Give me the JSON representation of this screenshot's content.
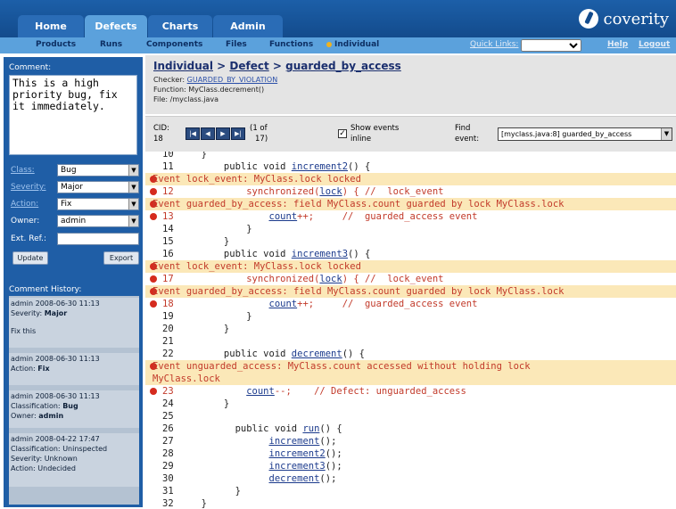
{
  "header": {
    "tabs": [
      {
        "label": "Home",
        "active": false
      },
      {
        "label": "Defects",
        "active": true
      },
      {
        "label": "Charts",
        "active": false
      },
      {
        "label": "Admin",
        "active": false
      }
    ],
    "logo_text": "coverity"
  },
  "subnav": {
    "items": [
      "Products",
      "Runs",
      "Components",
      "Files",
      "Functions",
      "Individual"
    ],
    "quick_links_label": "Quick Links:",
    "quick_links_value": "",
    "help": "Help",
    "logout": "Logout"
  },
  "sidebar": {
    "comment_label": "Comment:",
    "comment_text": "This is a high\npriority bug, fix\nit immediately.",
    "fields": [
      {
        "label": "Class:",
        "value": "Bug",
        "link": true
      },
      {
        "label": "Severity:",
        "value": "Major",
        "link": true
      },
      {
        "label": "Action:",
        "value": "Fix",
        "link": true
      },
      {
        "label": "Owner:",
        "value": "admin",
        "link": false
      }
    ],
    "ext_ref_label": "Ext. Ref.:",
    "ext_ref_value": "",
    "update_button": "Update",
    "export_button": "Export",
    "history_label": "Comment History:",
    "history": [
      {
        "line1": "admin 2008-06-30 11:13",
        "line2_key": "Severity:",
        "line2_val": "Major",
        "line3": "Fix this"
      },
      {
        "line1": "admin 2008-06-30 11:13",
        "line2_key": "Action:",
        "line2_val": "Fix",
        "line3": ""
      },
      {
        "line1": "admin 2008-06-30 11:13",
        "line2_key": "Classification:",
        "line2_val": "Bug",
        "line3_key": "Owner:",
        "line3_val": "admin"
      },
      {
        "line1": "admin 2008-04-22 17:47",
        "line2_key": "Classification:",
        "line2_val": "Uninspected",
        "line3_key": "Severity:",
        "line3_val": "Unknown",
        "line4_key": "Action:",
        "line4_val": "Undecided"
      }
    ]
  },
  "main": {
    "breadcrumb": {
      "part1": "Individual",
      "sep1": " > ",
      "part2": "Defect",
      "sep2": " > ",
      "part3": "guarded_by_access"
    },
    "checker_label": "Checker:",
    "checker_value": "GUARDED_BY_VIOLATION",
    "function_line": "Function: MyClass.decrement()",
    "file_line": "File: /myclass.java",
    "cid_label": "CID:",
    "cid_value": "18",
    "pager_text": "(1 of",
    "pager_text2": "17)",
    "show_events_label": "Show events",
    "show_events_label2": "inline",
    "show_events_checked": true,
    "find_label": "Find",
    "find_label2": "event:",
    "find_value": "[myclass.java:8] guarded_by_access"
  },
  "code": {
    "lines": [
      {
        "type": "code",
        "ln": "10",
        "text": "  }"
      },
      {
        "type": "code",
        "ln": "11",
        "pre": "      public void ",
        "link": "increment2",
        "post": "() {"
      },
      {
        "type": "event",
        "text": "Event lock_event: MyClass.lock locked"
      },
      {
        "type": "defect",
        "ln": "12",
        "pre": "          synchronized(",
        "link": "lock",
        "post": ") { //  lock_event"
      },
      {
        "type": "event",
        "text": "Event guarded_by_access: field MyClass.count guarded by lock MyClass.lock"
      },
      {
        "type": "defect",
        "ln": "13",
        "pre": "              ",
        "link": "count",
        "post": "++;     //  guarded_access event"
      },
      {
        "type": "code",
        "ln": "14",
        "text": "          }"
      },
      {
        "type": "code",
        "ln": "15",
        "text": "      }"
      },
      {
        "type": "code",
        "ln": "16",
        "pre": "      public void ",
        "link": "increment3",
        "post": "() {"
      },
      {
        "type": "event",
        "text": "Event lock_event: MyClass.lock locked"
      },
      {
        "type": "defect",
        "ln": "17",
        "pre": "          synchronized(",
        "link": "lock",
        "post": ") { //  lock_event"
      },
      {
        "type": "event",
        "text": "Event guarded_by_access: field MyClass.count guarded by lock MyClass.lock"
      },
      {
        "type": "defect",
        "ln": "18",
        "pre": "              ",
        "link": "count",
        "post": "++;     //  guarded_access event"
      },
      {
        "type": "code",
        "ln": "19",
        "text": "          }"
      },
      {
        "type": "code",
        "ln": "20",
        "text": "      }"
      },
      {
        "type": "code",
        "ln": "21",
        "text": ""
      },
      {
        "type": "code",
        "ln": "22",
        "pre": "      public void ",
        "link": "decrement",
        "post": "() {"
      },
      {
        "type": "event2",
        "text": "Event unguarded_access: MyClass.count accessed without holding lock\nMyClass.lock"
      },
      {
        "type": "defect",
        "ln": "23",
        "pre": "          ",
        "link": "count",
        "post": "--;    // Defect: unguarded_access"
      },
      {
        "type": "code",
        "ln": "24",
        "text": "      }"
      },
      {
        "type": "code",
        "ln": "25",
        "text": ""
      },
      {
        "type": "code",
        "ln": "26",
        "pre": "        public void ",
        "link": "run",
        "post": "() {"
      },
      {
        "type": "code",
        "ln": "27",
        "pre": "              ",
        "link": "increment",
        "post": "();"
      },
      {
        "type": "code",
        "ln": "28",
        "pre": "              ",
        "link": "increment2",
        "post": "();"
      },
      {
        "type": "code",
        "ln": "29",
        "pre": "              ",
        "link": "increment3",
        "post": "();"
      },
      {
        "type": "code",
        "ln": "30",
        "pre": "              ",
        "link": "decrement",
        "post": "();"
      },
      {
        "type": "code",
        "ln": "31",
        "text": "        }"
      },
      {
        "type": "code",
        "ln": "32",
        "text": "  }"
      }
    ]
  }
}
